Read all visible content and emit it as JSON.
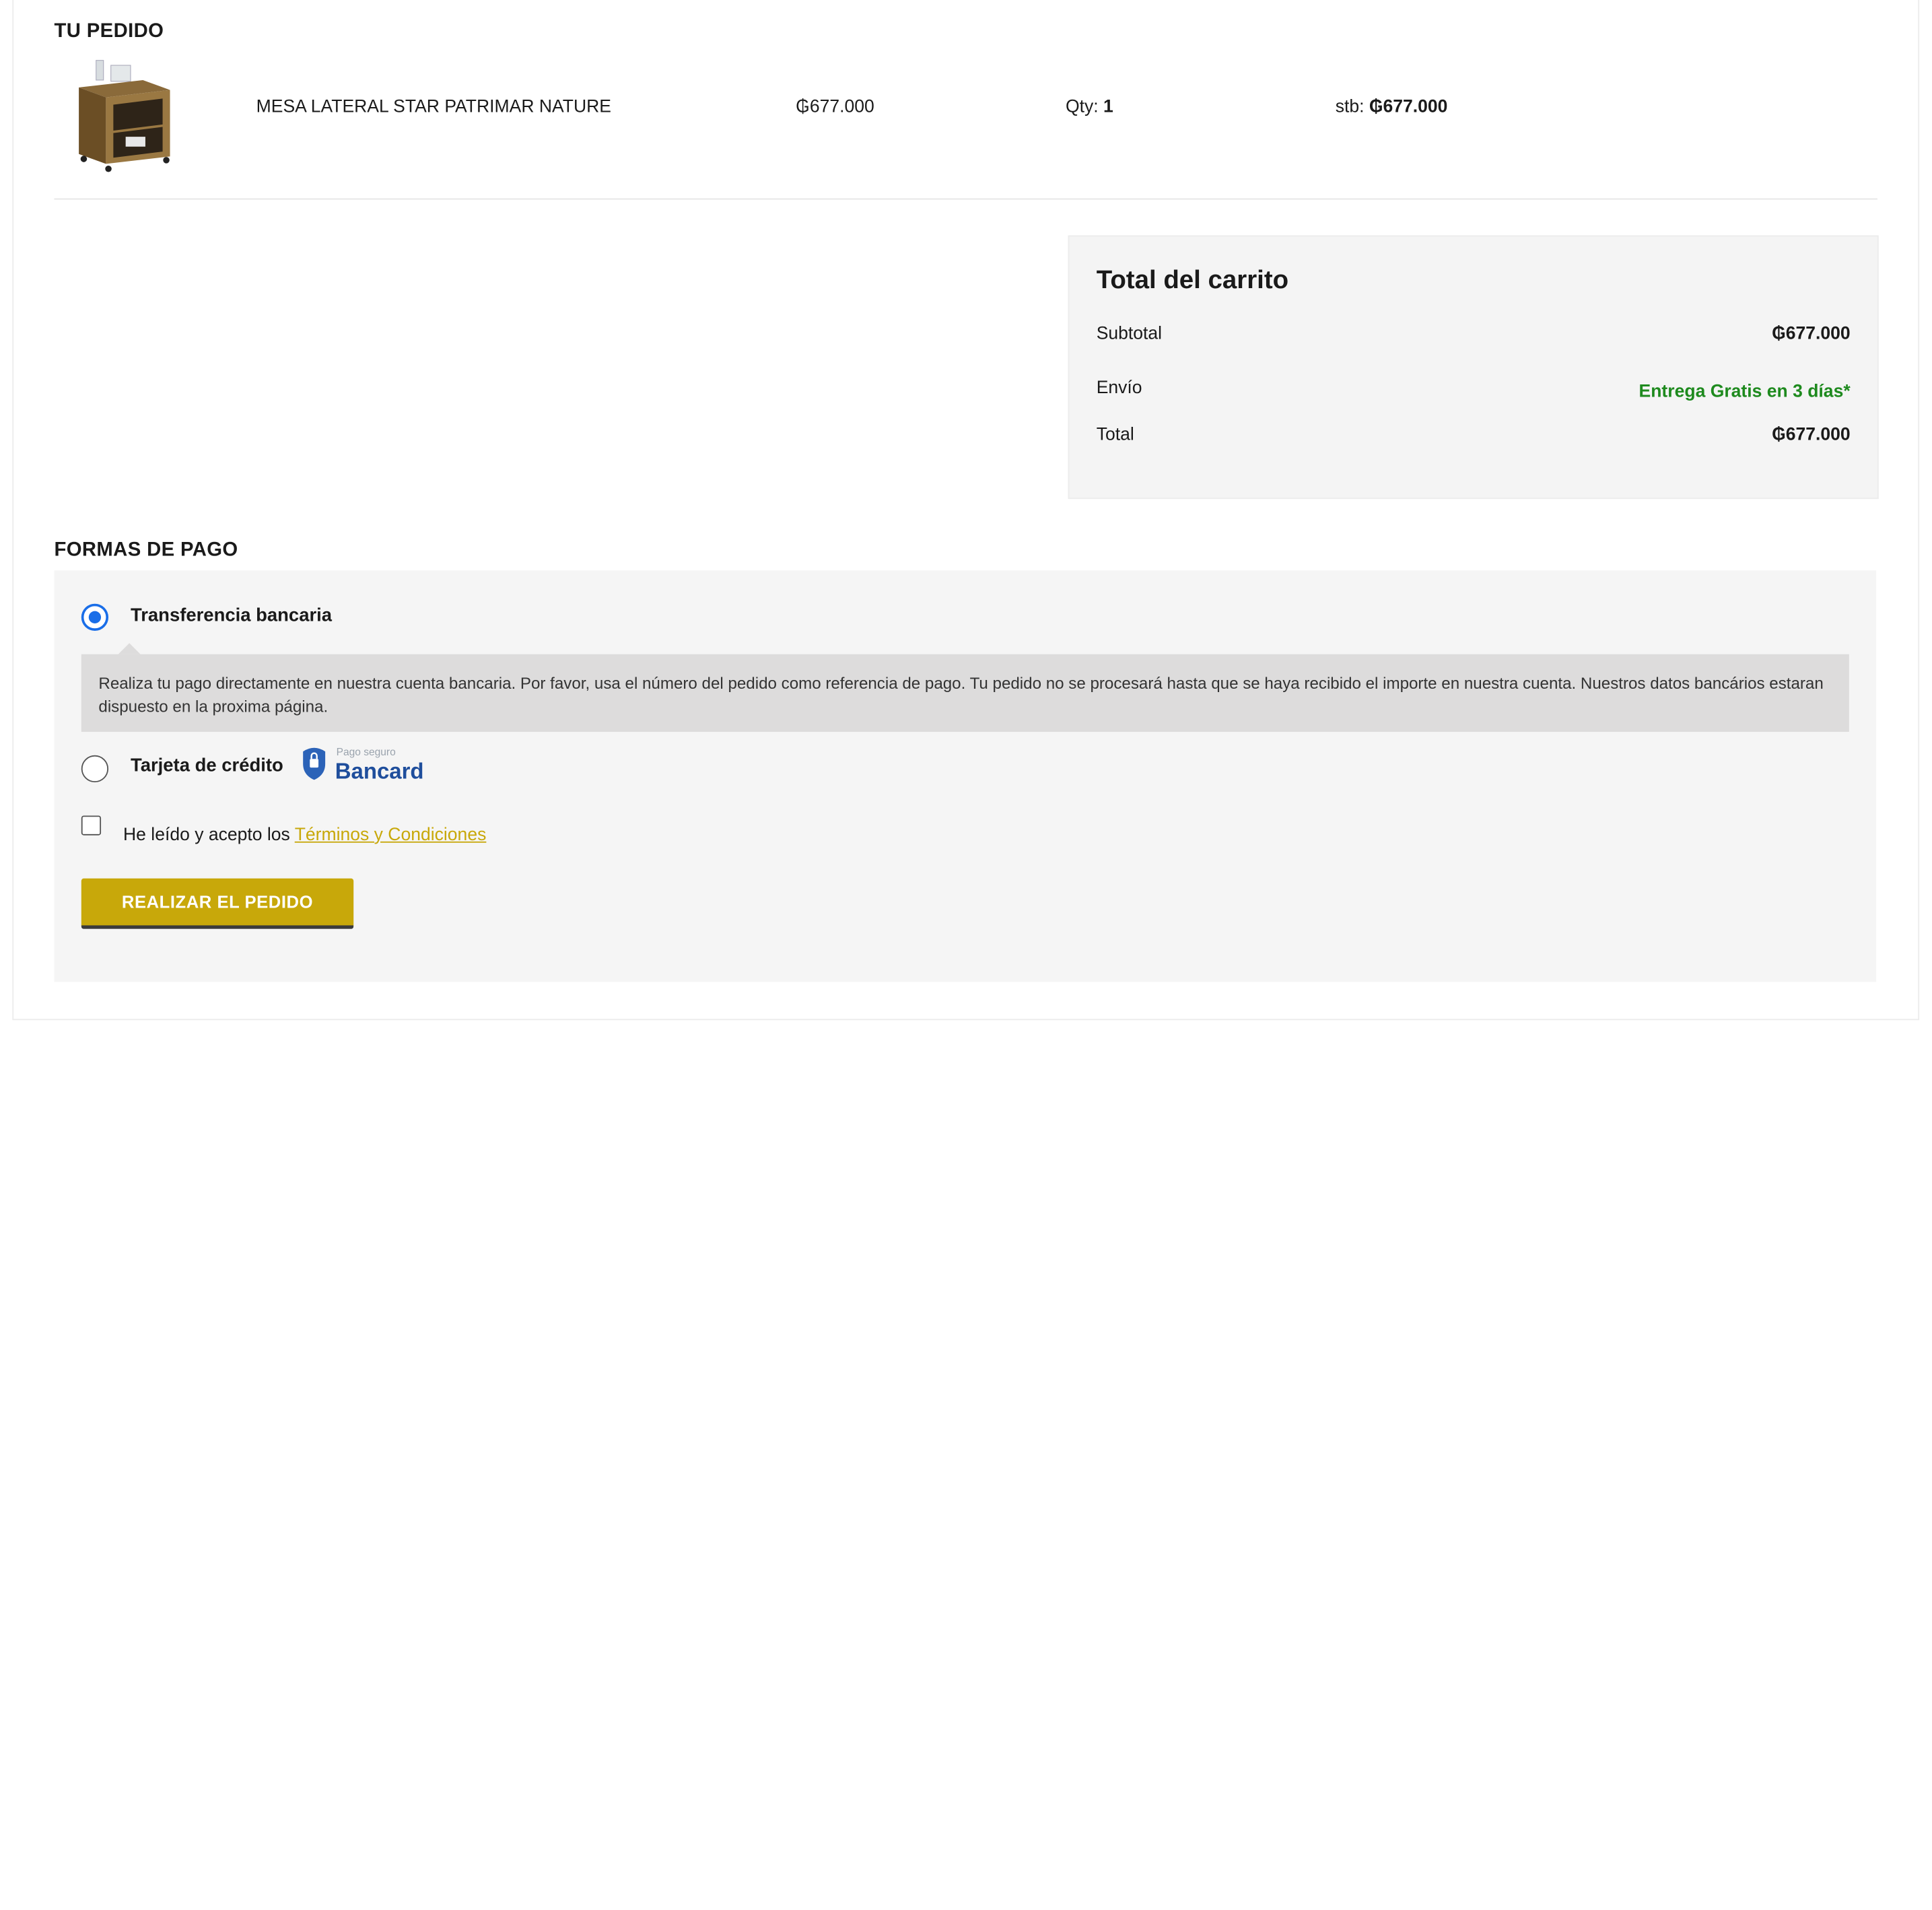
{
  "order": {
    "title": "TU PEDIDO",
    "item": {
      "name": "MESA LATERAL STAR PATRIMAR NATURE",
      "price": "₲677.000",
      "qty_label": "Qty:",
      "qty": "1",
      "subtotal_label": "stb:",
      "subtotal": "₲677.000"
    }
  },
  "totals": {
    "title": "Total del carrito",
    "subtotal_label": "Subtotal",
    "subtotal": "₲677.000",
    "shipping_label": "Envío",
    "shipping": "Entrega Gratis en 3 días*",
    "total_label": "Total",
    "total": "₲677.000"
  },
  "payment": {
    "title": "FORMAS DE PAGO",
    "transfer_label": "Transferencia bancaria",
    "transfer_selected": true,
    "transfer_description": "Realiza tu pago directamente en nuestra cuenta bancaria. Por favor, usa el número del pedido como referencia de pago. Tu pedido no se procesará hasta que se haya recibido el importe en nuestra cuenta. Nuestros datos bancários estaran dispuesto en la proxima página.",
    "card_label": "Tarjeta de crédito",
    "bancard_small": "Pago seguro",
    "bancard_brand": "Bancard",
    "terms_text": "He leído y acepto los ",
    "terms_link": "Términos y Condiciones",
    "submit_label": "REALIZAR EL PEDIDO"
  },
  "colors": {
    "accent": "#c8a80a",
    "free_shipping": "#1e8a1e",
    "radio_selected": "#1a6ee8"
  }
}
